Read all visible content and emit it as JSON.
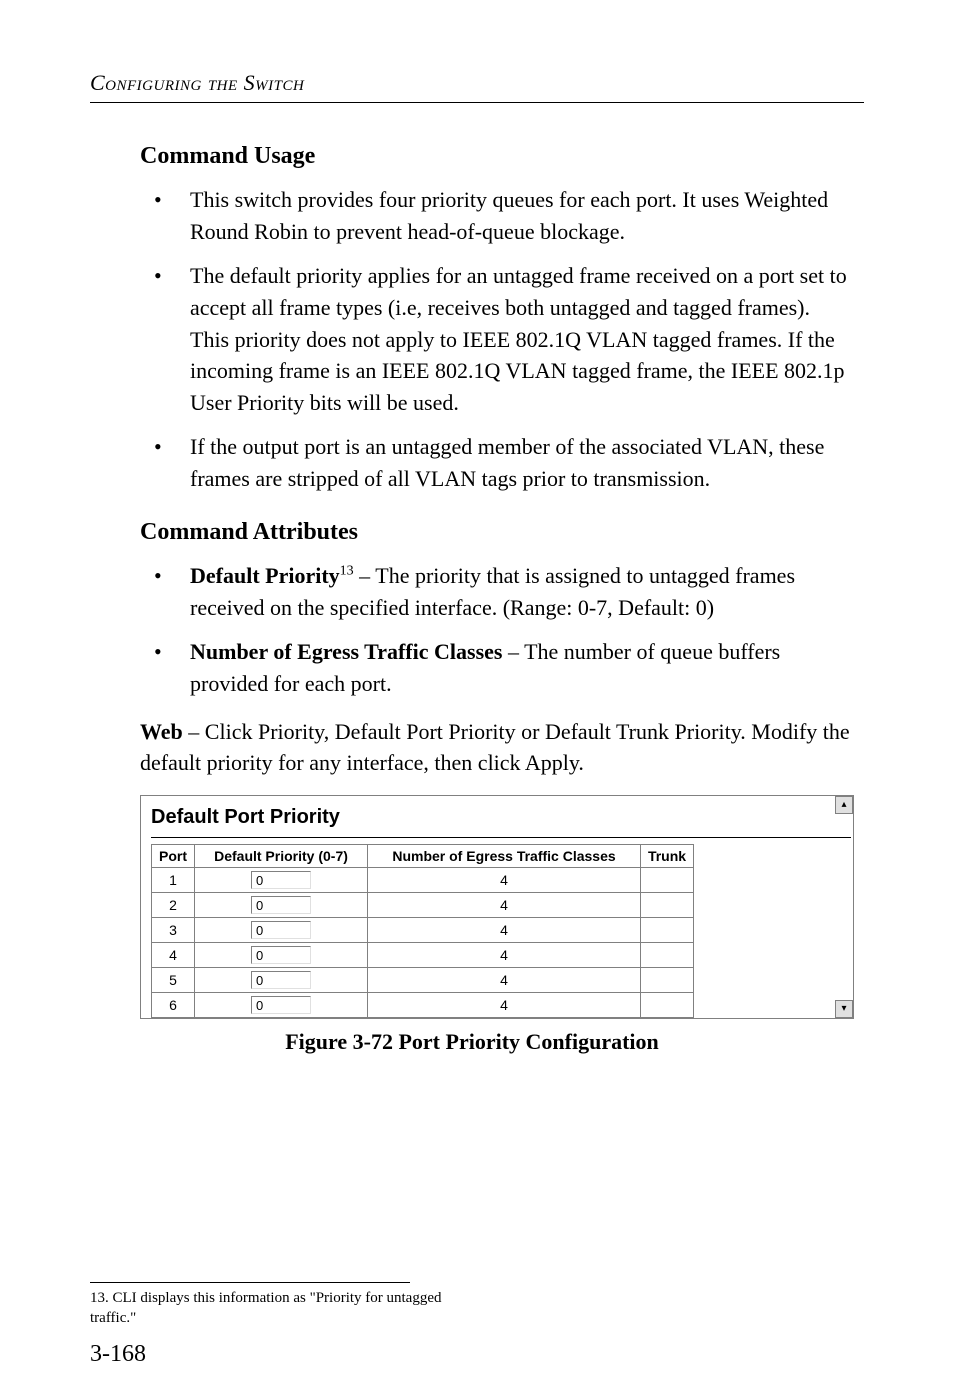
{
  "header": {
    "running_title": "Configuring the Switch"
  },
  "sections": {
    "command_usage": {
      "heading": "Command Usage",
      "bullets": [
        "This switch provides four priority queues for each port. It uses Weighted Round Robin to prevent head-of-queue blockage.",
        "The default priority applies for an untagged frame received on a port set to accept all frame types (i.e, receives both untagged and tagged frames). This priority does not apply to IEEE 802.1Q VLAN tagged frames. If the incoming frame is an IEEE 802.1Q VLAN tagged frame, the IEEE 802.1p User Priority bits will be used.",
        "If the output port is an untagged member of the associated VLAN, these frames are stripped of all VLAN tags prior to transmission."
      ]
    },
    "command_attributes": {
      "heading": "Command Attributes",
      "items": [
        {
          "term": "Default Priority",
          "sup": "13",
          "desc": " – The priority that is assigned to untagged frames received on the specified interface. (Range: 0-7, Default: 0)"
        },
        {
          "term": "Number of Egress Traffic Classes",
          "sup": "",
          "desc": " – The number of queue buffers provided for each port."
        }
      ]
    },
    "web_para": {
      "leadin": "Web",
      "rest": " – Click Priority, Default Port Priority or Default Trunk Priority. Modify the default priority for any interface, then click Apply."
    }
  },
  "figure": {
    "panel_title": "Default Port Priority",
    "columns": {
      "port": "Port",
      "priority": "Default Priority (0-7)",
      "egress": "Number of Egress Traffic Classes",
      "trunk": "Trunk"
    },
    "rows": [
      {
        "port": "1",
        "priority": "0",
        "egress": "4",
        "trunk": ""
      },
      {
        "port": "2",
        "priority": "0",
        "egress": "4",
        "trunk": ""
      },
      {
        "port": "3",
        "priority": "0",
        "egress": "4",
        "trunk": ""
      },
      {
        "port": "4",
        "priority": "0",
        "egress": "4",
        "trunk": ""
      },
      {
        "port": "5",
        "priority": "0",
        "egress": "4",
        "trunk": ""
      },
      {
        "port": "6",
        "priority": "0",
        "egress": "4",
        "trunk": ""
      }
    ],
    "caption": "Figure 3-72  Port Priority Configuration",
    "scroll_up_glyph": "▴",
    "scroll_down_glyph": "▾"
  },
  "footnote": {
    "marker": "13.",
    "text": "CLI displays this information as \"Priority for untagged traffic.\""
  },
  "page_number": "3-168"
}
